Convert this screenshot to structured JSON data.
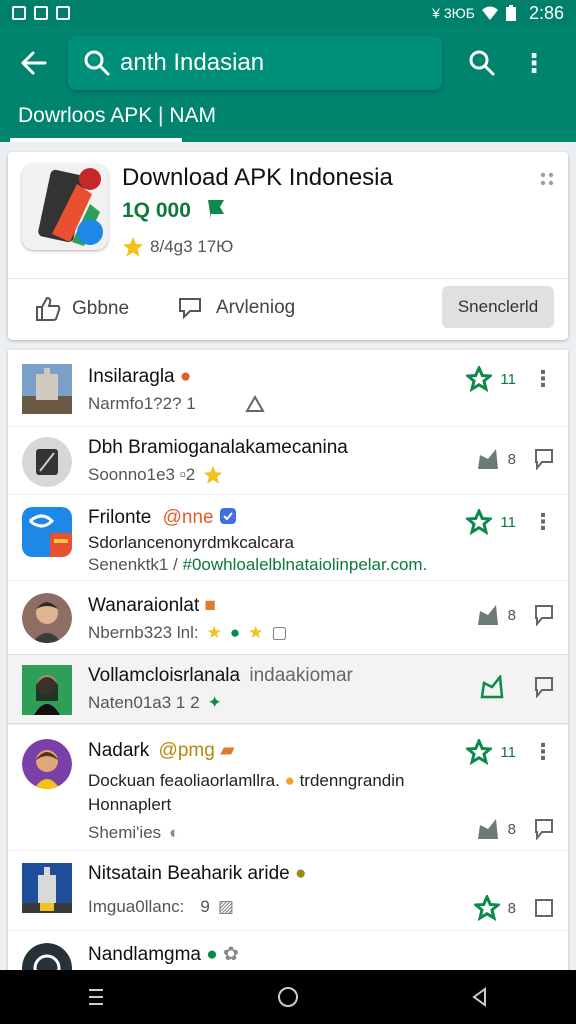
{
  "status_bar": {
    "signal": "¥ 3ЮБ",
    "time": "2:86"
  },
  "header": {
    "search_value": "anth Indasian",
    "tab_label": "Dowrloos APK | NAM"
  },
  "app_card": {
    "title": "Download APK Indonesia",
    "subtitle": "1Q 000",
    "rating_text": "8/4g3 17Ю",
    "action_like": "Gbbne",
    "action_share": "Arvleniog",
    "action_open": "Snenclerld"
  },
  "rows": [
    {
      "title": "Insilaragla",
      "meta": "Narmfo1?2?  1",
      "count": "11"
    },
    {
      "title": "Dbh Bramioganalakamecanina",
      "meta": "Soonno1e3 ▫2",
      "count": "8"
    },
    {
      "title": "Frilonte",
      "title_extra": "@nne",
      "line1": "Sdorlancenonyrdmkcalcara",
      "line2_prefix": "Senenktk1 /",
      "line2_link": "#0owhloalelblnataiolinpelar.com.",
      "count": "11"
    },
    {
      "title": "Wanaraionlat",
      "meta": "Nbernb323 lnl:",
      "count": "8"
    },
    {
      "title": "Vollamcloisrlanala",
      "title_extra": "indaakiomar",
      "meta": "Naten01a3 1 2"
    },
    {
      "title": "Nadark",
      "title_extra": "@pmg",
      "line1": "Dockuan feaoliaorlamllra.",
      "line1_extra": "trdenngrandin",
      "line2": "Honnaplert",
      "meta": "Shemi'ies",
      "count_top": "11",
      "count": "8"
    },
    {
      "title": "Nitsatain Beaharik aride",
      "meta": "Imgua0llanc:",
      "meta_num": "9",
      "count": "8"
    },
    {
      "title": "Nandlamgma"
    }
  ],
  "colors": {
    "primary": "#00846e",
    "accent_green": "#0d8a4a",
    "star": "#f2c11a"
  },
  "icons": [
    "back-arrow-icon",
    "search-icon",
    "more-vert-icon",
    "thumbs-up-icon",
    "share-icon",
    "star-icon",
    "bookmark-icon",
    "flag-icon"
  ]
}
